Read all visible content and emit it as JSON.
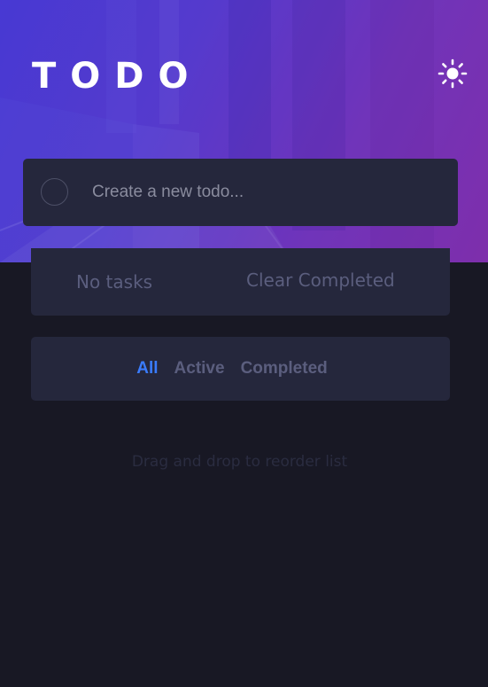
{
  "header": {
    "title": "TODO",
    "theme_toggle_icon": "sun-icon"
  },
  "new_todo": {
    "placeholder": "Create a new todo..."
  },
  "status": {
    "count_label": "No tasks",
    "clear_label": "Clear Completed"
  },
  "filters": {
    "items": [
      {
        "label": "All",
        "active": true
      },
      {
        "label": "Active",
        "active": false
      },
      {
        "label": "Completed",
        "active": false
      }
    ]
  },
  "hint": "Drag and drop to reorder list",
  "colors": {
    "background": "#181824",
    "card": "#25273c",
    "accent": "#3a7cfd",
    "muted_text": "#5b5e7e",
    "hero_start": "#4a3bd6",
    "hero_end": "#8a2fa8"
  }
}
